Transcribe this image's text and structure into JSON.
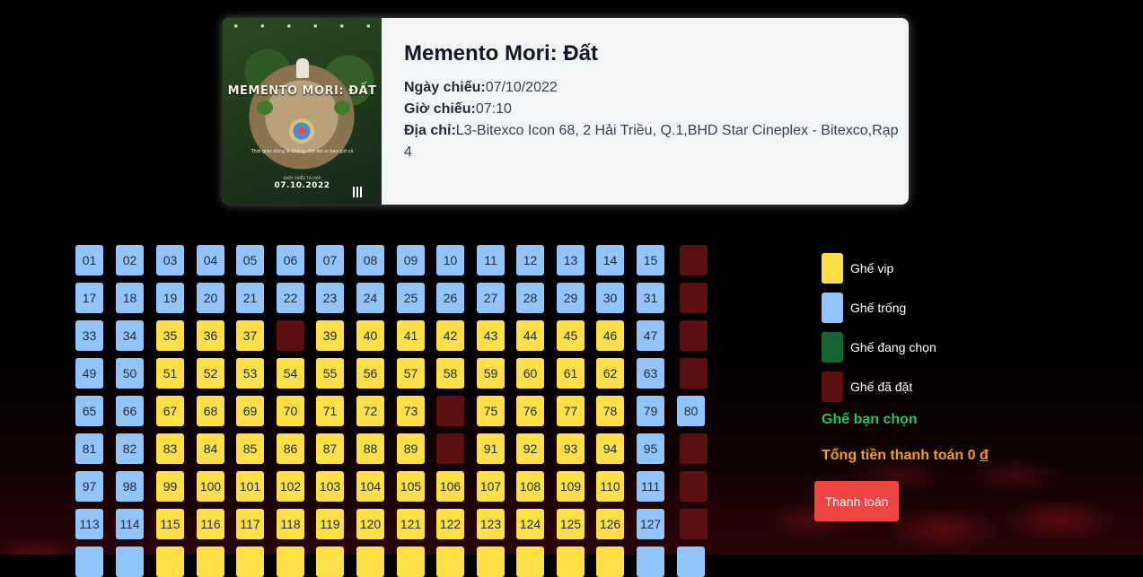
{
  "movie": {
    "title": "Memento Mori: Đất",
    "date_label": "Ngày chiếu:",
    "date": "07/10/2022",
    "time_label": "Giờ chiếu:",
    "time": "07:10",
    "address_label": "Địa chỉ:",
    "address": "L3-Bitexco Icon 68, 2 Hải Triều, Q.1,BHD Star Cineplex - Bitexco,Rạp 4"
  },
  "poster": {
    "title": "MEMENTO MORI: ĐẤT",
    "tagline": "Thời gian đúng là không chờ đợi ai bao giờ cả",
    "date_label": "KHỞI CHIẾU TẠI RẠP",
    "date": "07.10.2022"
  },
  "legend": [
    {
      "label": "Ghế vip",
      "color": "#fde047"
    },
    {
      "label": "Ghế trống",
      "color": "#93c5fd"
    },
    {
      "label": "Ghế đang chọn",
      "color": "#166534"
    },
    {
      "label": "Ghế đã đặt",
      "color": "#5b0f10"
    }
  ],
  "chosen_label": "Ghế bạn chọn",
  "total_label": "Tổng tiền thanh toán",
  "total_value": "0",
  "currency": "đ",
  "pay_button": "Thanh toán",
  "seat_colors": {
    "empty": "#93c5fd",
    "vip": "#fde047",
    "booked": "#5b0f10",
    "selected": "#166534"
  },
  "seat_rows": [
    [
      [
        "01",
        "empty"
      ],
      [
        "02",
        "empty"
      ],
      [
        "03",
        "empty"
      ],
      [
        "04",
        "empty"
      ],
      [
        "05",
        "empty"
      ],
      [
        "06",
        "empty"
      ],
      [
        "07",
        "empty"
      ],
      [
        "08",
        "empty"
      ],
      [
        "09",
        "empty"
      ],
      [
        "10",
        "empty"
      ],
      [
        "11",
        "empty"
      ],
      [
        "12",
        "empty"
      ],
      [
        "13",
        "empty"
      ],
      [
        "14",
        "empty"
      ],
      [
        "15",
        "empty"
      ],
      [
        "",
        "booked"
      ]
    ],
    [
      [
        "17",
        "empty"
      ],
      [
        "18",
        "empty"
      ],
      [
        "19",
        "empty"
      ],
      [
        "20",
        "empty"
      ],
      [
        "21",
        "empty"
      ],
      [
        "22",
        "empty"
      ],
      [
        "23",
        "empty"
      ],
      [
        "24",
        "empty"
      ],
      [
        "25",
        "empty"
      ],
      [
        "26",
        "empty"
      ],
      [
        "27",
        "empty"
      ],
      [
        "28",
        "empty"
      ],
      [
        "29",
        "empty"
      ],
      [
        "30",
        "empty"
      ],
      [
        "31",
        "empty"
      ],
      [
        "",
        "booked"
      ]
    ],
    [
      [
        "33",
        "empty"
      ],
      [
        "34",
        "empty"
      ],
      [
        "35",
        "vip"
      ],
      [
        "36",
        "vip"
      ],
      [
        "37",
        "vip"
      ],
      [
        "",
        "booked"
      ],
      [
        "39",
        "vip"
      ],
      [
        "40",
        "vip"
      ],
      [
        "41",
        "vip"
      ],
      [
        "42",
        "vip"
      ],
      [
        "43",
        "vip"
      ],
      [
        "44",
        "vip"
      ],
      [
        "45",
        "vip"
      ],
      [
        "46",
        "vip"
      ],
      [
        "47",
        "empty"
      ],
      [
        "",
        "booked"
      ]
    ],
    [
      [
        "49",
        "empty"
      ],
      [
        "50",
        "empty"
      ],
      [
        "51",
        "vip"
      ],
      [
        "52",
        "vip"
      ],
      [
        "53",
        "vip"
      ],
      [
        "54",
        "vip"
      ],
      [
        "55",
        "vip"
      ],
      [
        "56",
        "vip"
      ],
      [
        "57",
        "vip"
      ],
      [
        "58",
        "vip"
      ],
      [
        "59",
        "vip"
      ],
      [
        "60",
        "vip"
      ],
      [
        "61",
        "vip"
      ],
      [
        "62",
        "vip"
      ],
      [
        "63",
        "empty"
      ],
      [
        "",
        "booked"
      ]
    ],
    [
      [
        "65",
        "empty"
      ],
      [
        "66",
        "empty"
      ],
      [
        "67",
        "vip"
      ],
      [
        "68",
        "vip"
      ],
      [
        "69",
        "vip"
      ],
      [
        "70",
        "vip"
      ],
      [
        "71",
        "vip"
      ],
      [
        "72",
        "vip"
      ],
      [
        "73",
        "vip"
      ],
      [
        "",
        "booked"
      ],
      [
        "75",
        "vip"
      ],
      [
        "76",
        "vip"
      ],
      [
        "77",
        "vip"
      ],
      [
        "78",
        "vip"
      ],
      [
        "79",
        "empty"
      ],
      [
        "80",
        "empty"
      ]
    ],
    [
      [
        "81",
        "empty"
      ],
      [
        "82",
        "empty"
      ],
      [
        "83",
        "vip"
      ],
      [
        "84",
        "vip"
      ],
      [
        "85",
        "vip"
      ],
      [
        "86",
        "vip"
      ],
      [
        "87",
        "vip"
      ],
      [
        "88",
        "vip"
      ],
      [
        "89",
        "vip"
      ],
      [
        "",
        "booked"
      ],
      [
        "91",
        "vip"
      ],
      [
        "92",
        "vip"
      ],
      [
        "93",
        "vip"
      ],
      [
        "94",
        "vip"
      ],
      [
        "95",
        "empty"
      ],
      [
        "",
        "booked"
      ]
    ],
    [
      [
        "97",
        "empty"
      ],
      [
        "98",
        "empty"
      ],
      [
        "99",
        "vip"
      ],
      [
        "100",
        "vip"
      ],
      [
        "101",
        "vip"
      ],
      [
        "102",
        "vip"
      ],
      [
        "103",
        "vip"
      ],
      [
        "104",
        "vip"
      ],
      [
        "105",
        "vip"
      ],
      [
        "106",
        "vip"
      ],
      [
        "107",
        "vip"
      ],
      [
        "108",
        "vip"
      ],
      [
        "109",
        "vip"
      ],
      [
        "110",
        "vip"
      ],
      [
        "111",
        "empty"
      ],
      [
        "",
        "booked"
      ]
    ],
    [
      [
        "113",
        "empty"
      ],
      [
        "114",
        "empty"
      ],
      [
        "115",
        "vip"
      ],
      [
        "116",
        "vip"
      ],
      [
        "117",
        "vip"
      ],
      [
        "118",
        "vip"
      ],
      [
        "119",
        "vip"
      ],
      [
        "120",
        "vip"
      ],
      [
        "121",
        "vip"
      ],
      [
        "122",
        "vip"
      ],
      [
        "123",
        "vip"
      ],
      [
        "124",
        "vip"
      ],
      [
        "125",
        "vip"
      ],
      [
        "126",
        "vip"
      ],
      [
        "127",
        "empty"
      ],
      [
        "",
        "booked"
      ]
    ],
    [
      [
        "",
        "empty"
      ],
      [
        "",
        "empty"
      ],
      [
        "",
        "vip"
      ],
      [
        "",
        "vip"
      ],
      [
        "",
        "vip"
      ],
      [
        "",
        "vip"
      ],
      [
        "",
        "vip"
      ],
      [
        "",
        "vip"
      ],
      [
        "",
        "vip"
      ],
      [
        "",
        "vip"
      ],
      [
        "",
        "vip"
      ],
      [
        "",
        "vip"
      ],
      [
        "",
        "vip"
      ],
      [
        "",
        "vip"
      ],
      [
        "",
        "empty"
      ],
      [
        "",
        "empty"
      ]
    ]
  ]
}
